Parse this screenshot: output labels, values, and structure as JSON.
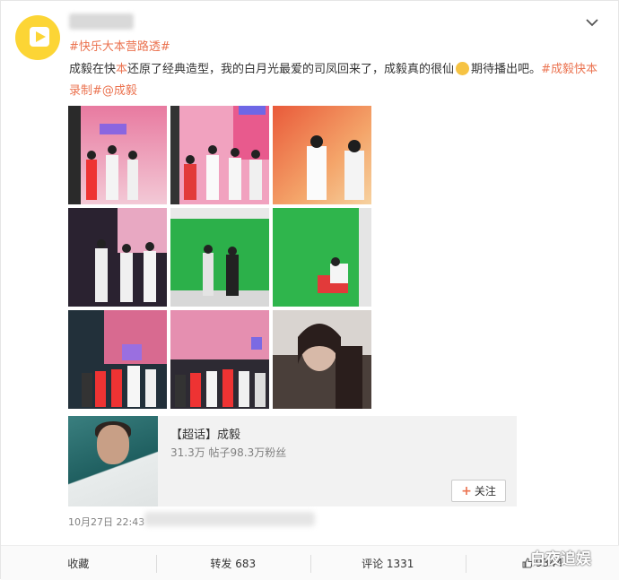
{
  "post": {
    "topic": "#快乐大本营路透#",
    "text_segments": [
      {
        "t": "成毅在快",
        "cls": ""
      },
      {
        "t": "本",
        "cls": "hl"
      },
      {
        "t": "还原了经典造型，我的白月光最爱的司凤回来了，成毅真的很仙",
        "cls": ""
      },
      {
        "t": "",
        "cls": "emoji"
      },
      {
        "t": "期待播出吧。",
        "cls": ""
      },
      {
        "t": "#成毅快",
        "cls": "link"
      },
      {
        "t": "本",
        "cls": "hl"
      },
      {
        "t": "录制#",
        "cls": "link"
      },
      {
        "t": "@成毅",
        "cls": "link"
      }
    ],
    "timestamp": "10月27日 22:43"
  },
  "supertopic_card": {
    "title": "【超话】成毅",
    "stats": "31.3万 帖子98.3万粉丝",
    "follow_label": "关注"
  },
  "actions": {
    "favorite": "收藏",
    "repost": "转发 683",
    "comment": "评论 1331",
    "like": "9344"
  },
  "watermark": "白夜追娱",
  "colors": {
    "accent": "#eb7350",
    "bar_bg": "#fafafa",
    "avatar_yellow": "#fcd535"
  },
  "icons": {
    "menu": "chevron-down-icon",
    "like": "thumb-up-icon",
    "follow": "plus-icon"
  }
}
